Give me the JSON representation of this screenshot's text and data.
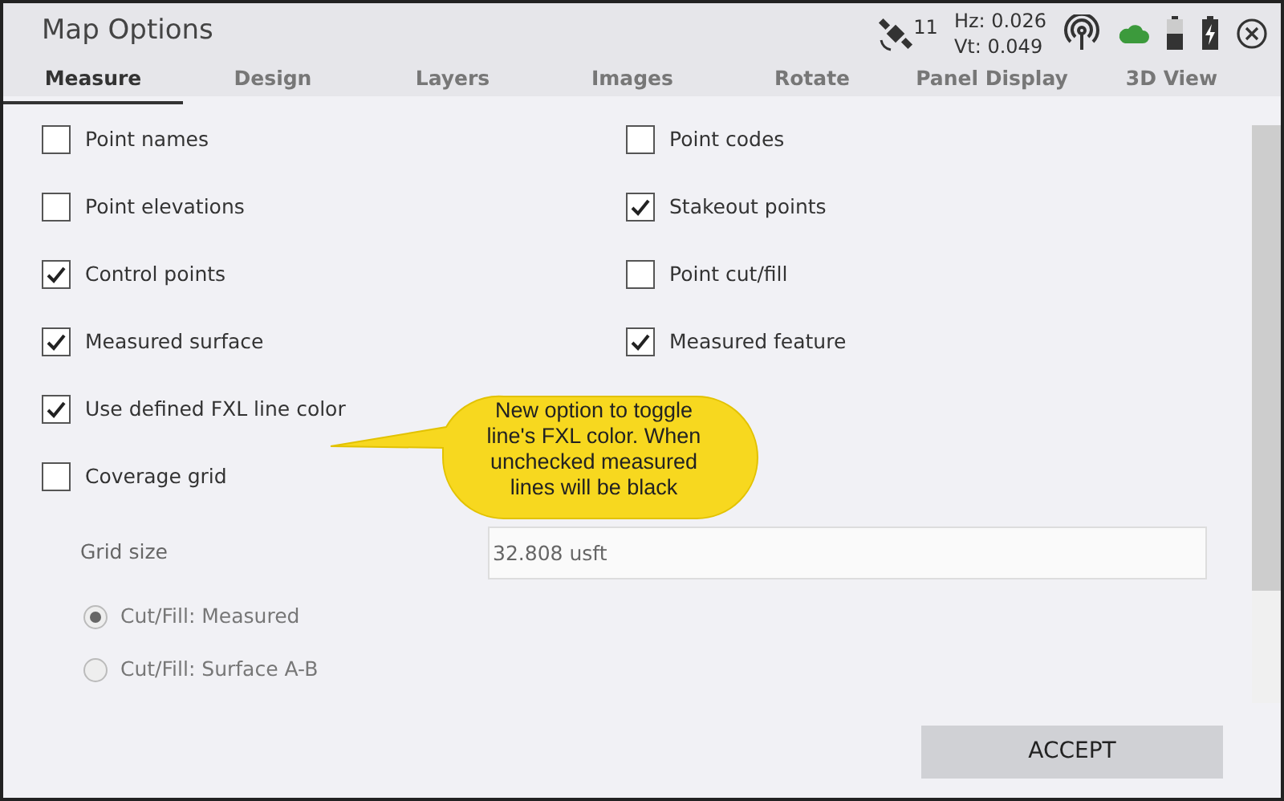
{
  "window": {
    "title": "Map Options"
  },
  "status": {
    "satellites": "11",
    "hz": "Hz: 0.026",
    "vt": "Vt: 0.049"
  },
  "tabs": [
    {
      "label": "Measure",
      "selected": true
    },
    {
      "label": "Design",
      "selected": false
    },
    {
      "label": "Layers",
      "selected": false
    },
    {
      "label": "Images",
      "selected": false
    },
    {
      "label": "Rotate",
      "selected": false
    },
    {
      "label": "Panel Display",
      "selected": false
    },
    {
      "label": "3D View",
      "selected": false
    }
  ],
  "option_rows": [
    [
      {
        "label": "Point names",
        "checked": false
      },
      {
        "label": "Point codes",
        "checked": false
      }
    ],
    [
      {
        "label": "Point elevations",
        "checked": false
      },
      {
        "label": "Stakeout points",
        "checked": true
      }
    ],
    [
      {
        "label": "Control points",
        "checked": true
      },
      {
        "label": "Point cut/fill",
        "checked": false
      }
    ],
    [
      {
        "label": "Measured surface",
        "checked": true
      },
      {
        "label": "Measured feature",
        "checked": true
      }
    ],
    [
      {
        "label": "Use defined FXL line color",
        "checked": true
      }
    ],
    [
      {
        "label": "Coverage grid",
        "checked": false
      }
    ]
  ],
  "grid_size": {
    "label": "Grid size",
    "value": "32.808 usft"
  },
  "radios": [
    {
      "label": "Cut/Fill: Measured",
      "selected": true
    },
    {
      "label": "Cut/Fill: Surface A-B",
      "selected": false
    }
  ],
  "callout": {
    "text": "New option to toggle line's FXL color. When unchecked measured lines will be black"
  },
  "accept_button": "ACCEPT"
}
